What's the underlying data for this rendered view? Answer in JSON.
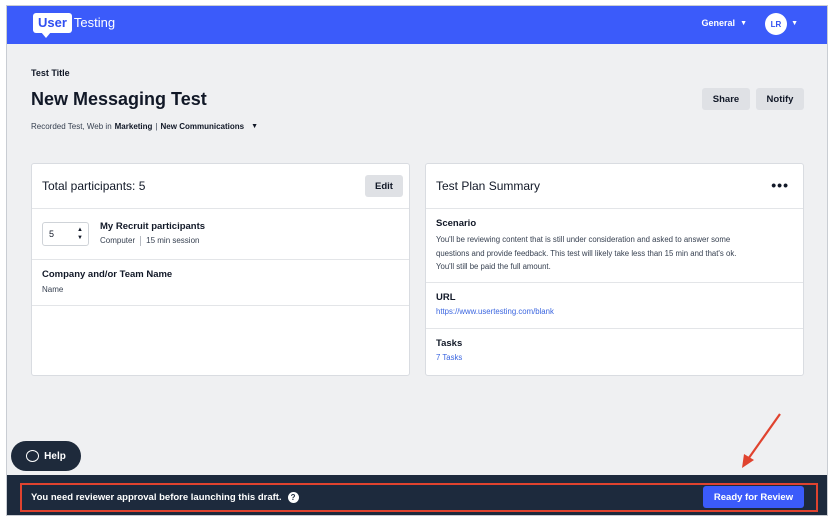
{
  "header": {
    "logo_box": "User",
    "logo_text": "Testing",
    "org": "General",
    "avatar": "LR"
  },
  "test": {
    "label": "Test Title",
    "name": "New Messaging Test",
    "meta_prefix": "Recorded Test, Web in",
    "folder": "Marketing",
    "divider": "|",
    "subfolder": "New Communications"
  },
  "actions": {
    "share": "Share",
    "notify": "Notify"
  },
  "participants": {
    "title": "Total participants: 5",
    "edit": "Edit",
    "count": "5",
    "recruit_title": "My Recruit participants",
    "device": "Computer",
    "session": "15 min session",
    "company_title": "Company and/or Team Name",
    "company_sub": "Name"
  },
  "plan": {
    "title": "Test Plan Summary",
    "more": "•••",
    "scenario_title": "Scenario",
    "scenario_line1": "You'll be reviewing content that is still under consideration and asked to answer some",
    "scenario_line2": "questions and provide feedback. This test will likely take less than 15 min and that's ok.",
    "scenario_line3": "You'll still be paid the full amount.",
    "url_title": "URL",
    "url": "https://www.usertesting.com/blank",
    "tasks_title": "Tasks",
    "tasks": "7 Tasks"
  },
  "help": "Help",
  "footer": {
    "approval": "You need reviewer approval before launching this draft.",
    "question": "?",
    "review": "Ready for Review"
  },
  "colors": {
    "brand": "#3b5bfa",
    "footer_bg": "#1d2a3d",
    "highlight": "#e0432f"
  }
}
